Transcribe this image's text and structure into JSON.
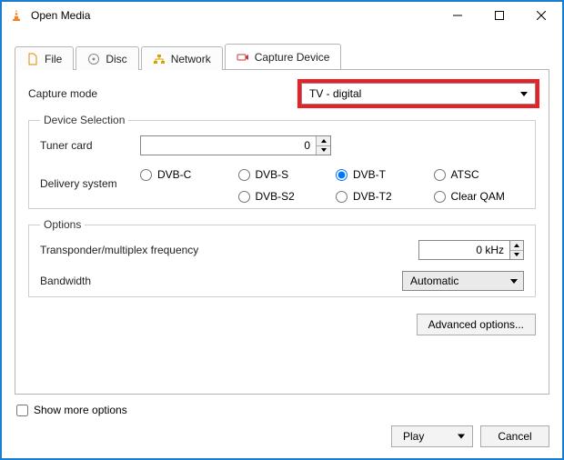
{
  "window": {
    "title": "Open Media"
  },
  "tabs": {
    "file": "File",
    "disc": "Disc",
    "network": "Network",
    "capture": "Capture Device"
  },
  "capture": {
    "mode_label": "Capture mode",
    "mode_value": "TV - digital"
  },
  "device_selection": {
    "legend": "Device Selection",
    "tuner_label": "Tuner card",
    "tuner_value": "0",
    "delivery_label": "Delivery system",
    "radios": {
      "dvbc": "DVB-C",
      "dvbs": "DVB-S",
      "dvbt": "DVB-T",
      "atsc": "ATSC",
      "dvbs2": "DVB-S2",
      "dvbt2": "DVB-T2",
      "clearqam": "Clear QAM"
    },
    "selected": "dvbt"
  },
  "options": {
    "legend": "Options",
    "freq_label": "Transponder/multiplex frequency",
    "freq_value": "0 kHz",
    "bandwidth_label": "Bandwidth",
    "bandwidth_value": "Automatic",
    "advanced_label": "Advanced options..."
  },
  "footer": {
    "show_more": "Show more options",
    "play": "Play",
    "cancel": "Cancel"
  }
}
